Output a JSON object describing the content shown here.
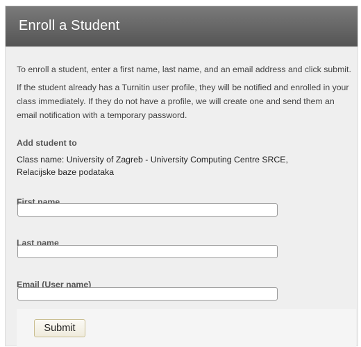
{
  "header": {
    "title": "Enroll a Student"
  },
  "instructions": {
    "line1": "To enroll a student, enter a first name, last name, and an email address and click submit.",
    "line2": "If the student already has a Turnitin user profile, they will be notified and enrolled in your class immediately. If they do not have a profile, we will create one and send them an email notification with a temporary password."
  },
  "class_info": {
    "heading": "Add student to",
    "class_name_line1": "Class name: University of Zagreb - University Computing Centre SRCE,",
    "class_name_line2": "Relacijske baze podataka"
  },
  "form": {
    "first_name_label": "First name",
    "first_name_value": "",
    "last_name_label": "Last name",
    "last_name_value": "",
    "email_label": "Email (User name)",
    "email_value": ""
  },
  "actions": {
    "submit_label": "Submit"
  }
}
